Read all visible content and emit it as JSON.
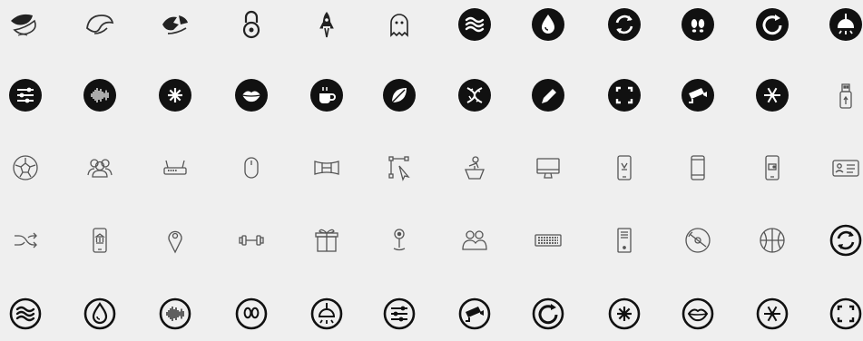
{
  "rows": [
    [
      "fortune-cookie-icon",
      "fortune-cookie-outline-icon",
      "fortune-cookie-broken-icon",
      "padlock-icon",
      "rocket-icon",
      "ghost-icon",
      "waves-circle-icon",
      "water-drop-circle-icon",
      "refresh-circle-icon",
      "footprints-circle-icon",
      "reload-circle-icon",
      "ceiling-lamp-circle-icon"
    ],
    [
      "sliders-circle-icon",
      "soundwave-circle-icon",
      "asterisk-circle-icon",
      "lips-circle-icon",
      "coffee-cup-circle-icon",
      "leaf-circle-icon",
      "dna-circle-icon",
      "pencil-circle-icon",
      "fullscreen-circle-icon",
      "security-camera-circle-icon",
      "snowflake-circle-icon",
      "usb-drive-icon"
    ],
    [
      "soccer-ball-icon",
      "user-group-icon",
      "router-icon",
      "computer-mouse-icon",
      "panorama-icon",
      "vector-path-icon",
      "podium-speaker-icon",
      "desktop-monitor-icon",
      "smartphone-ribbon-icon",
      "smartphone-icon",
      "smartphone-wallet-icon",
      "id-card-icon"
    ],
    [
      "shuffle-icon",
      "smartphone-bank-icon",
      "map-pin-icon",
      "dumbbell-icon",
      "gift-box-icon",
      "location-marker-icon",
      "team-icon",
      "keyboard-icon",
      "desktop-tower-icon",
      "compact-disc-icon",
      "basketball-icon",
      "refresh-outline-circle-icon"
    ],
    [
      "waves-outline-circle-icon",
      "water-drop-outline-circle-icon",
      "soundwave-outline-circle-icon",
      "footprints-outline-circle-icon",
      "ceiling-lamp-outline-circle-icon",
      "sliders-outline-circle-icon",
      "security-camera-outline-circle-icon",
      "reload-outline-circle-icon",
      "asterisk-outline-circle-icon",
      "lips-outline-circle-icon",
      "snowflake-outline-circle-icon",
      "fullscreen-outline-circle-icon"
    ]
  ]
}
